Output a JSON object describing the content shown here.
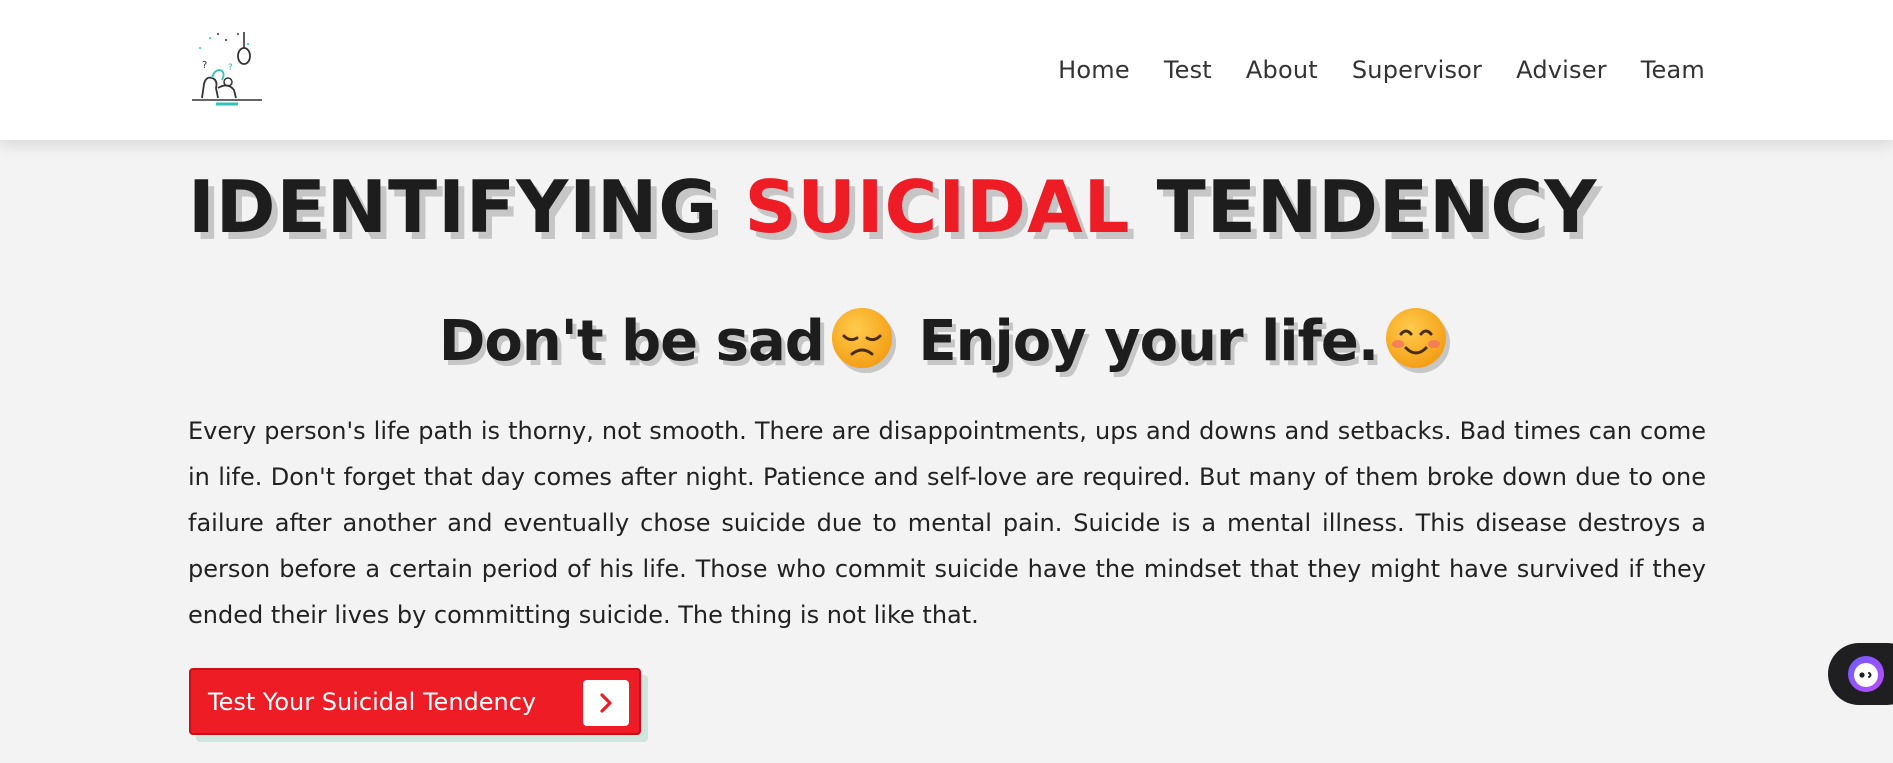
{
  "header": {
    "logo_icon": "suicide-awareness-logo",
    "nav": [
      "Home",
      "Test",
      "About",
      "Supervisor",
      "Adviser",
      "Team"
    ]
  },
  "hero": {
    "title_before": "IDENTIFYING ",
    "title_accent": "SUICIDAL",
    "title_after": " TENDENCY",
    "subtitle_part1": "Don't be sad",
    "subtitle_part2": "Enjoy your life.",
    "emoji_1": "sad-face-emoji",
    "emoji_2": "smiling-face-emoji",
    "paragraph": "Every person's life path is thorny, not smooth. There are disappointments, ups and downs and setbacks. Bad times can come in life. Don't forget that day comes after night. Patience and self-love are required. But many of them broke down due to one failure after another and eventually chose suicide due to mental pain. Suicide is a mental illness. This disease destroys a person before a certain period of his life. Those who commit suicide have the mindset that they might have survived if they ended their lives by committing suicide. The thing is not like that.",
    "cta_label": "Test Your Suicidal Tendency",
    "cta_icon": "chevron-right-icon"
  },
  "widget": {
    "icon": "chatbot-icon"
  },
  "colors": {
    "accent": "#ee1c25",
    "text": "#1d1d1d",
    "background": "#f3f3f3",
    "header_bg": "#ffffff",
    "logo_teal": "#2ec4b6"
  }
}
